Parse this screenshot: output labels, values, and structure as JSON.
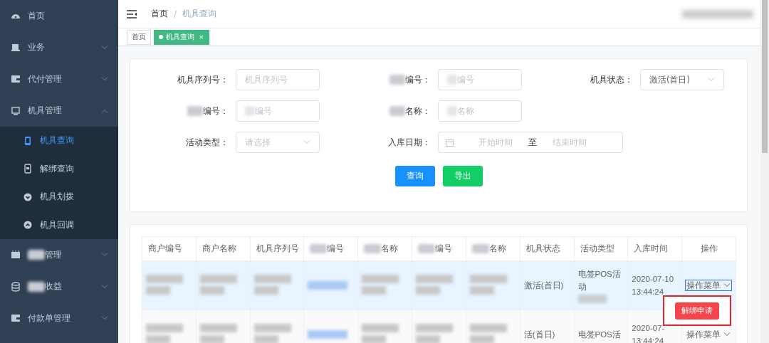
{
  "sidebar": {
    "items": [
      {
        "label": "首页",
        "redacted": false,
        "has_children": false
      },
      {
        "label": "业务",
        "redacted": false,
        "has_children": true,
        "expanded": false
      },
      {
        "label": "代付管理",
        "redacted": false,
        "has_children": true,
        "expanded": false
      },
      {
        "label": "机具管理",
        "redacted": false,
        "has_children": true,
        "expanded": true,
        "children": [
          {
            "label": "机具查询",
            "selected": true
          },
          {
            "label": "解绑查询",
            "selected": false
          },
          {
            "label": "机具划拨",
            "selected": false
          },
          {
            "label": "机具回调",
            "selected": false
          }
        ]
      },
      {
        "label": "管理",
        "redacted": true,
        "has_children": true,
        "expanded": false
      },
      {
        "label": "收益",
        "redacted": true,
        "has_children": true,
        "expanded": false
      },
      {
        "label": "付款单管理",
        "redacted": false,
        "has_children": true,
        "expanded": false
      }
    ]
  },
  "header": {
    "breadcrumb": [
      {
        "label": "首页",
        "current": false
      },
      {
        "label": "机具查询",
        "current": true
      }
    ],
    "separator": "/",
    "user_redacted": true
  },
  "tags": [
    {
      "label": "首页",
      "selected": false
    },
    {
      "label": "机具查询",
      "selected": true,
      "close": "×"
    }
  ],
  "filter": {
    "rows": [
      [
        {
          "kind": "input",
          "label": "机具序列号：",
          "label_redacted": false,
          "placeholder": "机具序列号",
          "placeholder_redacted": false
        },
        {
          "kind": "input",
          "label": "编号：",
          "label_redacted": true,
          "placeholder": "编号",
          "placeholder_redacted": true
        },
        {
          "kind": "select",
          "label": "机具状态：",
          "label_redacted": false,
          "value": "激活(首日)"
        }
      ],
      [
        {
          "kind": "input",
          "label": "编号：",
          "label_redacted": true,
          "placeholder": "编号",
          "placeholder_redacted": true
        },
        {
          "kind": "input",
          "label": "名称：",
          "label_redacted": true,
          "placeholder": "名称",
          "placeholder_redacted": true
        }
      ],
      [
        {
          "kind": "select",
          "label": "活动类型：",
          "label_redacted": false,
          "placeholder": "请选择"
        },
        {
          "kind": "daterange",
          "label": "入库日期：",
          "label_redacted": false,
          "start_placeholder": "开始时间",
          "separator": "至",
          "end_placeholder": "结束时间"
        }
      ]
    ],
    "buttons": [
      {
        "label": "查询"
      },
      {
        "label": "导出"
      }
    ]
  },
  "table": {
    "columns": [
      {
        "label": "商户编号",
        "redacted": false
      },
      {
        "label": "商户名称",
        "redacted": false
      },
      {
        "label": "机具序列号",
        "redacted": false
      },
      {
        "label": "编号",
        "redacted": true
      },
      {
        "label": "名称",
        "redacted": true
      },
      {
        "label": "编号",
        "redacted": true
      },
      {
        "label": "名称",
        "redacted": true
      },
      {
        "label": "机具状态",
        "redacted": false
      },
      {
        "label": "活动类型",
        "redacted": false
      },
      {
        "label": "入库时间",
        "redacted": false
      },
      {
        "label": "操作",
        "redacted": false
      }
    ],
    "rows": [
      {
        "selected": true,
        "cells": [
          {
            "kind": "redacted"
          },
          {
            "kind": "redacted"
          },
          {
            "kind": "redacted"
          },
          {
            "kind": "redacted-link"
          },
          {
            "kind": "redacted"
          },
          {
            "kind": "redacted"
          },
          {
            "kind": "redacted"
          },
          {
            "kind": "text",
            "text": "激活(首日)"
          },
          {
            "kind": "text-redacted",
            "text": "电签POS活动"
          },
          {
            "kind": "text",
            "text": "2020-07-10 13:44:24"
          },
          {
            "kind": "dropdown",
            "text": "操作菜单",
            "focused": true
          }
        ]
      },
      {
        "selected": false,
        "cells": [
          {
            "kind": "redacted"
          },
          {
            "kind": "redacted"
          },
          {
            "kind": "redacted"
          },
          {
            "kind": "redacted-link"
          },
          {
            "kind": "redacted"
          },
          {
            "kind": "redacted"
          },
          {
            "kind": "redacted"
          },
          {
            "kind": "text",
            "text": "活(首日)"
          },
          {
            "kind": "text",
            "text": "电签POS活"
          },
          {
            "kind": "text",
            "text": "2020-07- 13:44:24"
          },
          {
            "kind": "dropdown",
            "text": "操作菜单",
            "focused": false
          }
        ]
      }
    ]
  },
  "dropdown_menu": {
    "items": [
      {
        "label": "解绑申请"
      }
    ],
    "highlighted": true
  }
}
